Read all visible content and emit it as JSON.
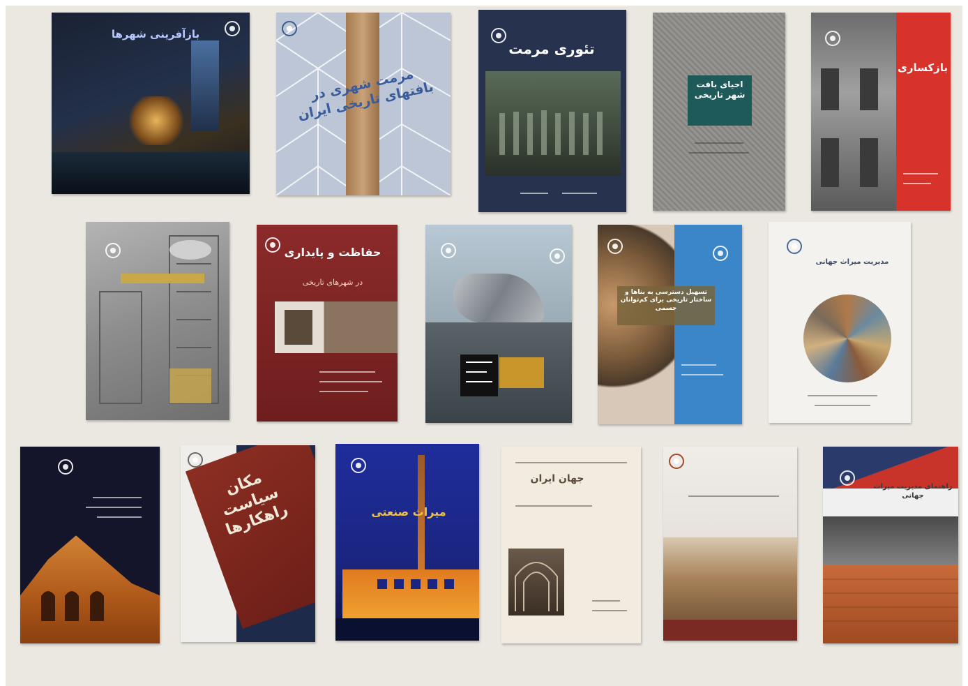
{
  "books": [
    {
      "id": "book-1",
      "title": "بازآفرینی شهرها"
    },
    {
      "id": "book-2",
      "title": "مرمت شهری در بافتهای تاریخی ایران"
    },
    {
      "id": "book-3",
      "title": "تئوری مرمت"
    },
    {
      "id": "book-4",
      "title": "احیای بافت شهر تاریخی"
    },
    {
      "id": "book-5",
      "title": "بازکساری"
    },
    {
      "id": "book-6",
      "title": ""
    },
    {
      "id": "book-7",
      "title": "حفاظت و پایداری",
      "subtitle": "در شهرهای تاریخی"
    },
    {
      "id": "book-8",
      "title": ""
    },
    {
      "id": "book-9",
      "title": "تسهیل دسترسی به بناها و ساختار تاریخی برای کم‌توانان جسمی"
    },
    {
      "id": "book-10",
      "title": "مدیریت میراث جهانی"
    },
    {
      "id": "book-11",
      "title": ""
    },
    {
      "id": "book-12",
      "title": "مکان سیاست راهکارها"
    },
    {
      "id": "book-13",
      "title": "میراث صنعتی"
    },
    {
      "id": "book-14",
      "title": "جهان ایران"
    },
    {
      "id": "book-15",
      "title": ""
    },
    {
      "id": "book-16",
      "title": "راهنمای مدیریت میراث جهانی"
    }
  ]
}
